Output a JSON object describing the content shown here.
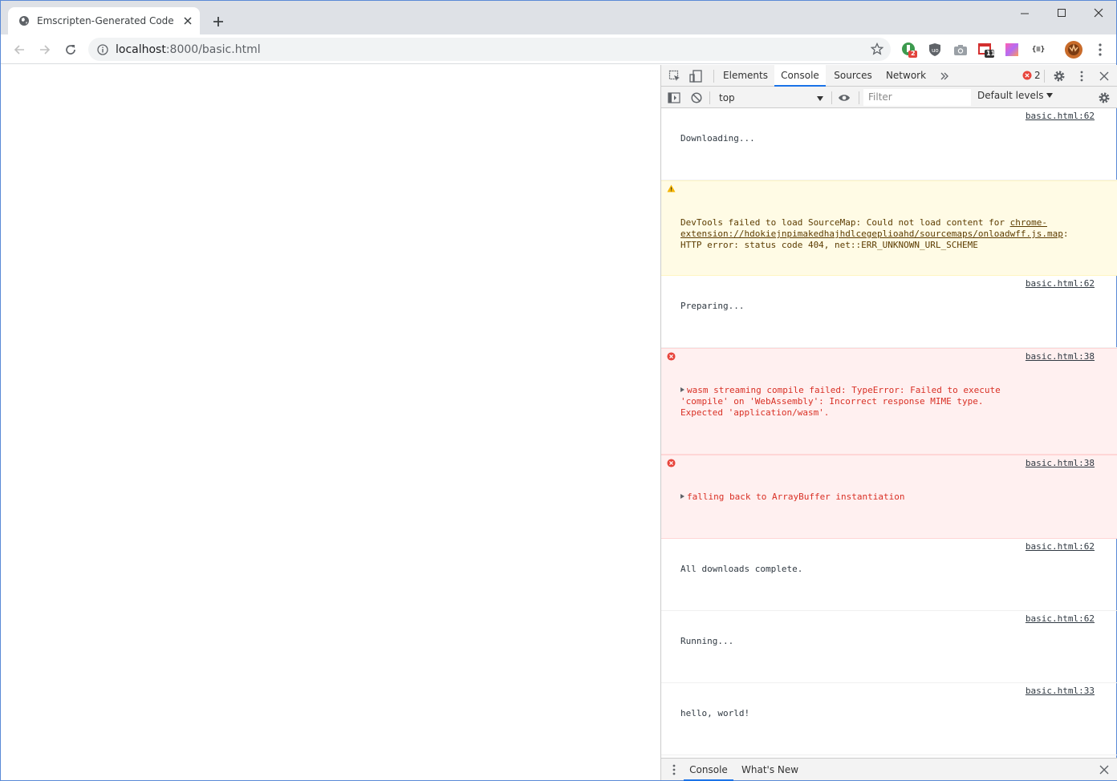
{
  "browser": {
    "tab_title": "Emscripten-Generated Code",
    "url_host": "localhost",
    "url_rest": ":8000/basic.html"
  },
  "extensions": {
    "ext1_badge": "2",
    "ext4_badge": "11",
    "ext6_label": "{≡}"
  },
  "devtools": {
    "tabs": [
      "Elements",
      "Console",
      "Sources",
      "Network"
    ],
    "error_count": "2",
    "context": "top",
    "filter_placeholder": "Filter",
    "levels": "Default levels",
    "messages": [
      {
        "type": "log",
        "text": "Downloading...",
        "source": "basic.html:62"
      },
      {
        "type": "warn",
        "text_before": "DevTools failed to load SourceMap: Could not load content for ",
        "link": "chrome-extension://hdokiejnpimakedhajhdlcegeplioahd/sourcemaps/onloadwff.js.map",
        "text_after": ": HTTP error: status code 404, net::ERR_UNKNOWN_URL_SCHEME"
      },
      {
        "type": "log",
        "text": "Preparing...",
        "source": "basic.html:62"
      },
      {
        "type": "error",
        "text": "wasm streaming compile failed: TypeError: Failed to execute 'compile' on 'WebAssembly': Incorrect response MIME type. Expected 'application/wasm'.",
        "source": "basic.html:38"
      },
      {
        "type": "error",
        "text": "falling back to ArrayBuffer instantiation",
        "source": "basic.html:38"
      },
      {
        "type": "log",
        "text": "All downloads complete.",
        "source": "basic.html:62"
      },
      {
        "type": "log",
        "text": "Running...",
        "source": "basic.html:62"
      },
      {
        "type": "log",
        "text": "hello, world!",
        "source": "basic.html:33"
      }
    ],
    "drawer_tabs": [
      "Console",
      "What's New"
    ]
  }
}
